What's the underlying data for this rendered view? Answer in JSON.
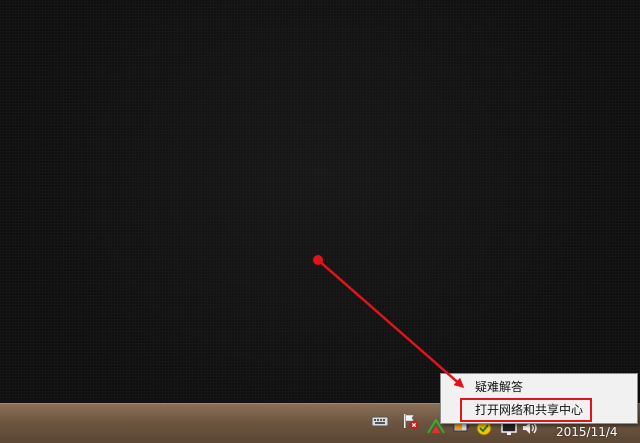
{
  "context_menu": {
    "items": [
      {
        "label": "疑难解答"
      },
      {
        "label": "打开网络和共享中心"
      }
    ]
  },
  "taskbar": {
    "clock_date": "2015/11/4",
    "tray_icons": [
      "keyboard-icon",
      "action-center-flag-icon",
      "network-icon",
      "power-icon",
      "security-icon",
      "display-icon",
      "volume-icon"
    ]
  },
  "annotation": {
    "color": "#e0141a",
    "target": "打开网络和共享中心"
  }
}
